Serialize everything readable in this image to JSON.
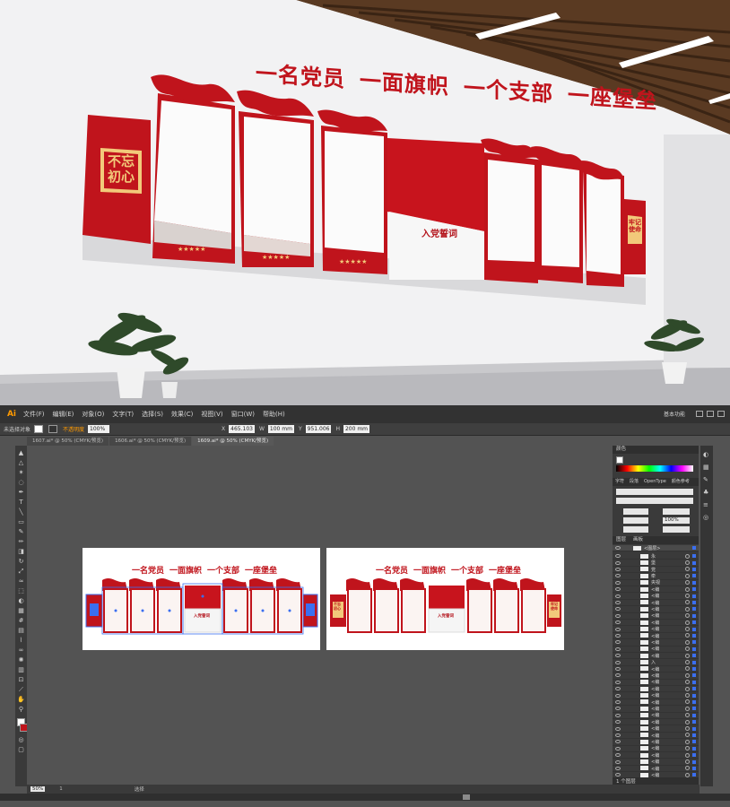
{
  "render": {
    "slogan": [
      "一名党员",
      "一面旗帜",
      "一个支部",
      "一座堡垒"
    ],
    "left_seal": [
      "不忘",
      "初心"
    ],
    "right_seal": [
      "牢记",
      "使命"
    ],
    "oath_label": "入党誓词",
    "stars": "★★★★★"
  },
  "menubar": {
    "logo": "Ai",
    "items": [
      "文件(F)",
      "编辑(E)",
      "对象(O)",
      "文字(T)",
      "选择(S)",
      "效果(C)",
      "视图(V)",
      "窗口(W)",
      "帮助(H)"
    ],
    "workspace": "基本功能"
  },
  "controlbar": {
    "object_label": "未选择对象",
    "opacity_label": "不透明度",
    "opacity_value": "100%",
    "x_value": "465.103",
    "w_value": "100 mm",
    "y_value": "951.006",
    "h_value": "200 mm"
  },
  "tabs": [
    "1607.ai* @ 50% (CMYK/预览)",
    "1606.ai* @ 50% (CMYK/预览)",
    "1609.ai* @ 50% (CMYK/预览)"
  ],
  "artboards": {
    "title": [
      "一名党员",
      "一面旗帜",
      "一个支部",
      "一座堡垒"
    ],
    "oath_label": "入党誓词",
    "left_seal": [
      "不忘",
      "初心"
    ],
    "right_seal": [
      "牢记",
      "使命"
    ]
  },
  "rightpanel": {
    "color_tab": "颜色",
    "char_tabs": [
      "字符",
      "段落",
      "OpenType",
      "颜色参考"
    ],
    "size_value": "100%",
    "layers_tabs": [
      "图层",
      "画板"
    ],
    "top_layer": "<图层>",
    "layers": [
      "永",
      "堡",
      "党",
      "牵",
      "央视",
      "<编",
      "<编",
      "<编",
      "<编",
      "<编",
      "<编",
      "<编",
      "<编",
      "<编",
      "<编",
      "<编",
      "入",
      "<编",
      "<编",
      "<编",
      "<编",
      "<编",
      "<编",
      "<编",
      "<编",
      "<编",
      "<编",
      "<编",
      "<编",
      "<编",
      "<编",
      "<编",
      "<编",
      "<编"
    ],
    "footer": "1 个图层"
  },
  "statusbar": {
    "zoom": "50%",
    "page": "1",
    "mode": "选择"
  },
  "colors": {
    "red": "#c0141c",
    "ui_dark": "#323232",
    "ui_mid": "#535353",
    "ai_orange": "#ff9a00"
  }
}
